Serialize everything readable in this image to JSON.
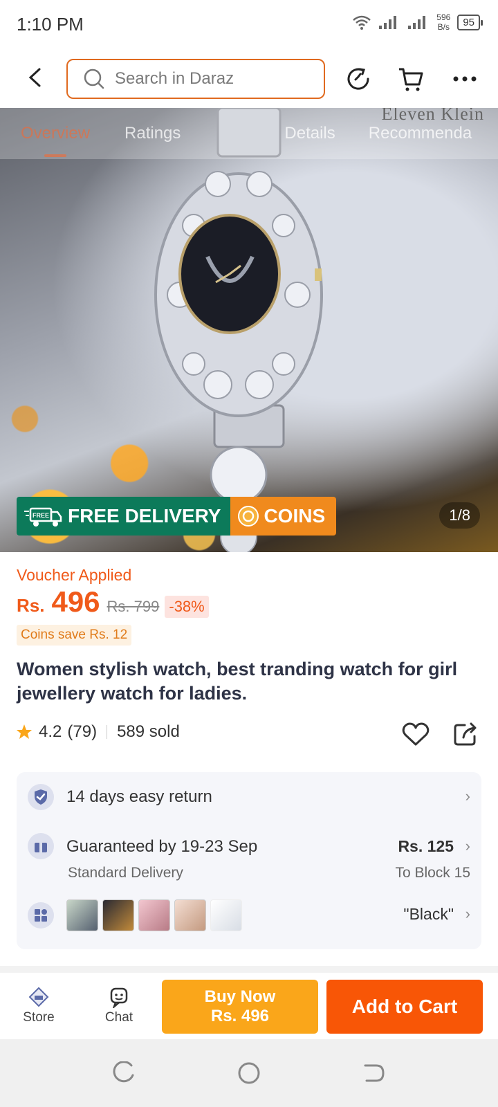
{
  "status_bar": {
    "time": "1:10 PM",
    "net_speed_value": "596",
    "net_speed_unit": "B/s",
    "battery": "95"
  },
  "header": {
    "search_placeholder": "Search in Daraz"
  },
  "hero": {
    "brand_text": "Eleven Klein",
    "tabs": [
      "Overview",
      "Ratings",
      "Details",
      "Recommenda"
    ],
    "active_tab": "Overview",
    "badge_free_text": "FREE DELIVERY",
    "badge_free_icon_text": "FREE",
    "badge_coins_text": "COINS",
    "image_counter": "1/8"
  },
  "product": {
    "voucher_text": "Voucher Applied",
    "currency": "Rs.",
    "price": "496",
    "original_price": "Rs. 799",
    "discount": "-38%",
    "coins_save": "Coins save Rs. 12",
    "title": "Women stylish watch, best tranding watch for girl jewellery watch for ladies.",
    "rating": "4.2",
    "rating_count": "(79)",
    "sold": "589 sold"
  },
  "info": {
    "return_text": "14 days easy return",
    "delivery_text": "Guaranteed by 19-23 Sep",
    "delivery_sub": "Standard Delivery",
    "delivery_price": "Rs. 125",
    "delivery_location": "To Block 15",
    "variant_selected": "\"Black\""
  },
  "actions": {
    "store_label": "Store",
    "chat_label": "Chat",
    "buy_now_label": "Buy Now",
    "buy_now_price": "Rs. 496",
    "add_to_cart_label": "Add to Cart"
  },
  "colors": {
    "accent": "#f85606",
    "buy_now": "#faa61a",
    "free_delivery_green": "#0c7a5a",
    "coins_orange": "#f08a1d"
  }
}
